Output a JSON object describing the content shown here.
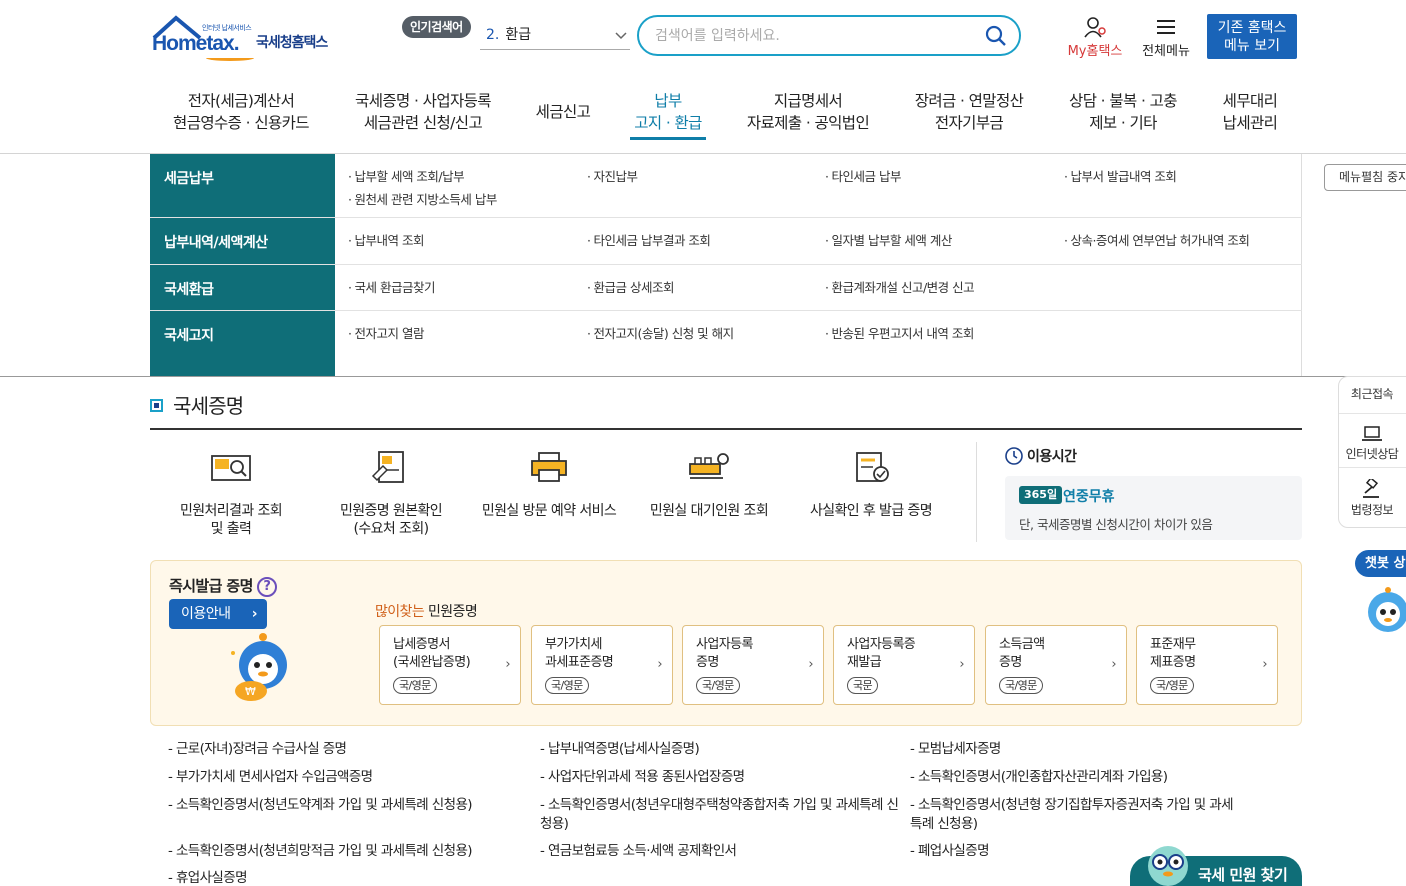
{
  "header": {
    "logo_small": "인터넷 납세서비스",
    "logo_main": "Hometax.",
    "logo_kr": "국세청홈택스",
    "popular_badge": "인기검색어",
    "popular_num": "2.",
    "popular_term": "환급",
    "search_placeholder": "검색어를 입력하세요.",
    "my_hometax": "My홈택스",
    "all_menu": "전체메뉴",
    "old_menu_line1": "기존 홈택스",
    "old_menu_line2": "메뉴 보기"
  },
  "gnb": [
    {
      "l1": "전자(세금)계산서",
      "l2": "현금영수증 · 신용카드"
    },
    {
      "l1": "국세증명 · 사업자등록",
      "l2": "세금관련 신청/신고"
    },
    {
      "l1": "세금신고",
      "l2": ""
    },
    {
      "l1": "납부",
      "l2": "고지 · 환급"
    },
    {
      "l1": "지급명세서",
      "l2": "자료제출 · 공익법인"
    },
    {
      "l1": "장려금 · 연말정산",
      "l2": "전자기부금"
    },
    {
      "l1": "상담 · 불복 · 고충",
      "l2": "제보 · 기타"
    },
    {
      "l1": "세무대리",
      "l2": "납세관리"
    }
  ],
  "dropdown": {
    "fold_button": "메뉴펼침 중지",
    "rows": [
      {
        "cat": "세금납부",
        "links": [
          "납부할 세액 조회/납부",
          "자진납부",
          "타인세금 납부",
          "납부서 발급내역 조회",
          "원천세 관련 지방소득세 납부"
        ]
      },
      {
        "cat": "납부내역/세액계산",
        "links": [
          "납부내역 조회",
          "타인세금 납부결과 조회",
          "일자별 납부할 세액 계산",
          "상속·증여세 연부연납 허가내역 조회"
        ]
      },
      {
        "cat": "국세환급",
        "links": [
          "국세 환급금찾기",
          "환급금 상세조회",
          "환급계좌개설 신고/변경 신고"
        ]
      },
      {
        "cat": "국세고지",
        "links": [
          "전자고지 열람",
          "전자고지(송달) 신청 및 해지",
          "반송된 우편고지서 내역 조회"
        ]
      }
    ]
  },
  "quick": {
    "recent": "최근접속",
    "chat": "인터넷상담",
    "law": "법령정보",
    "chatbot": "챗봇 상담"
  },
  "section": {
    "title": "국세증명",
    "services": [
      {
        "l1": "민원처리결과 조회",
        "l2": "및 출력"
      },
      {
        "l1": "민원증명 원본확인",
        "l2": "(수요처 조회)"
      },
      {
        "l1": "민원실 방문 예약 서비스",
        "l2": ""
      },
      {
        "l1": "민원실 대기인원 조회",
        "l2": ""
      },
      {
        "l1": "사실확인 후 발급 증명",
        "l2": ""
      }
    ],
    "time": {
      "title": "이용시간",
      "badge": "365일",
      "main": "연중무휴",
      "sub": "단, 국세증명별 신청시간이 차이가 있음"
    }
  },
  "instant": {
    "title": "즉시발급 증명",
    "help": "?",
    "guide": "이용안내",
    "popular_hl": "많이찾는",
    "popular_rest": " 민원증명",
    "certs": [
      {
        "l1": "납세증명서",
        "l2": "(국세완납증명)",
        "lang": "국/영문"
      },
      {
        "l1": "부가가치세",
        "l2": "과세표준증명",
        "lang": "국/영문"
      },
      {
        "l1": "사업자등록",
        "l2": "증명",
        "lang": "국/영문"
      },
      {
        "l1": "사업자등록증",
        "l2": "재발급",
        "lang": "국문"
      },
      {
        "l1": "소득금액",
        "l2": "증명",
        "lang": "국/영문"
      },
      {
        "l1": "표준재무",
        "l2": "제표증명",
        "lang": "국/영문"
      }
    ]
  },
  "cert_list": [
    "근로(자녀)장려금 수급사실 증명",
    "납부내역증명(납세사실증명)",
    "모범납세자증명",
    "부가가치세 면세사업자 수입금액증명",
    "사업자단위과세 적용 종된사업장증명",
    "소득확인증명서(개인종합자산관리계좌 가입용)",
    "소득확인증명서(청년도약계좌 가입 및 과세특례 신청용)",
    "소득확인증명서(청년우대형주택청약종합저축 가입 및 과세특례 신청용)",
    "소득확인증명서(청년형 장기집합투자증권저축 가입 및 과세특례 신청용)",
    "소득확인증명서(청년희망적금 가입 및 과세특례 신청용)",
    "연금보험료등 소득·세액 공제확인서",
    "폐업사실증명",
    "휴업사실증명"
  ],
  "find_button": "국세 민원 찾기",
  "colors": {
    "teal": "#0f6e78",
    "blue": "#1a64b8",
    "accent": "#0f7ea8",
    "orange": "#d0601a"
  }
}
